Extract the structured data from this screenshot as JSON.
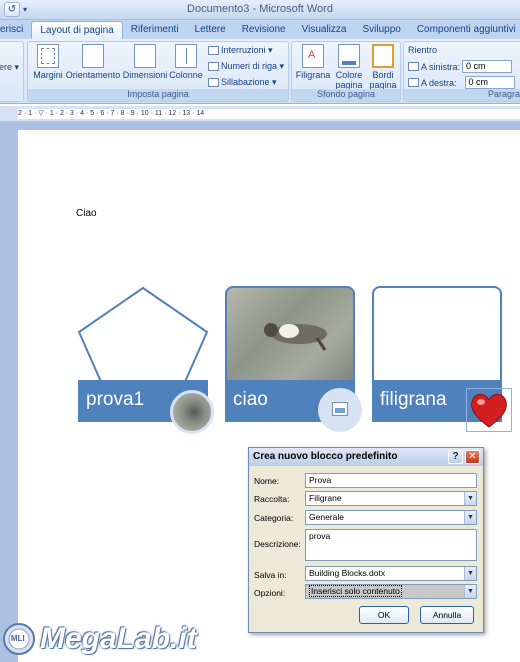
{
  "window": {
    "title": "Documento3 - Microsoft Word",
    "qat_undo": "↺",
    "qat_arrow": "▾"
  },
  "tabs": [
    {
      "label": "erisci"
    },
    {
      "label": "Layout di pagina"
    },
    {
      "label": "Riferimenti"
    },
    {
      "label": "Lettere"
    },
    {
      "label": "Revisione"
    },
    {
      "label": "Visualizza"
    },
    {
      "label": "Sviluppo"
    },
    {
      "label": "Componenti aggiuntivi"
    }
  ],
  "ribbon": {
    "cut_label": "ere ▾",
    "margini": "Margini",
    "orientamento": "Orientamento",
    "dimensioni": "Dimensioni",
    "colonne": "Colonne",
    "interruzioni": "Interruzioni ▾",
    "numeri_riga": "Numeri di riga ▾",
    "sillabazione": "Sillabazione ▾",
    "imposta_pagina": "Imposta pagina",
    "filigrana": "Filigrana",
    "colore_pagina_1": "Colore",
    "colore_pagina_2": "pagina ▾",
    "bordi_pagina_1": "Bordi",
    "bordi_pagina_2": "pagina",
    "sfondo_pagina": "Sfondo pagina",
    "rientro": "Rientro",
    "a_sinistra": "A sinistra:",
    "a_sinistra_val": "0 cm",
    "a_destra": "A destra:",
    "a_destra_val": "0 cm",
    "paragrafo": "Paragra"
  },
  "ruler": {
    "text": "2 · 1 · ▽ · 1 · 2 · 3 · 4 · 5 · 6 · 7 · 8 · 9 · 10 · 11 · 12 · 13 · 14"
  },
  "document": {
    "text": "Ciao",
    "cards": [
      {
        "label": "prova1"
      },
      {
        "label": "ciao"
      },
      {
        "label": "filigrana"
      }
    ]
  },
  "dialog": {
    "title": "Crea nuovo blocco predefinito",
    "help": "?",
    "close": "✕",
    "nome_label": "Nome:",
    "nome_value": "Prova",
    "raccolta_label": "Raccolta:",
    "raccolta_value": "Filigrane",
    "categoria_label": "Categoria:",
    "categoria_value": "Generale",
    "descrizione_label": "Descrizione:",
    "descrizione_value": "prova",
    "salva_label": "Salva in:",
    "salva_value": "Building Blocks.dotx",
    "opzioni_label": "Opzioni:",
    "opzioni_value": "Inserisci solo contenuto",
    "ok": "OK",
    "annulla": "Annulla"
  },
  "watermark": {
    "text": "MegaLab.it",
    "badge": "MLI"
  },
  "colors": {
    "accent": "#4f81bd",
    "ribbon": "#d5e4f5",
    "doc_bg": "#aac1e3"
  }
}
